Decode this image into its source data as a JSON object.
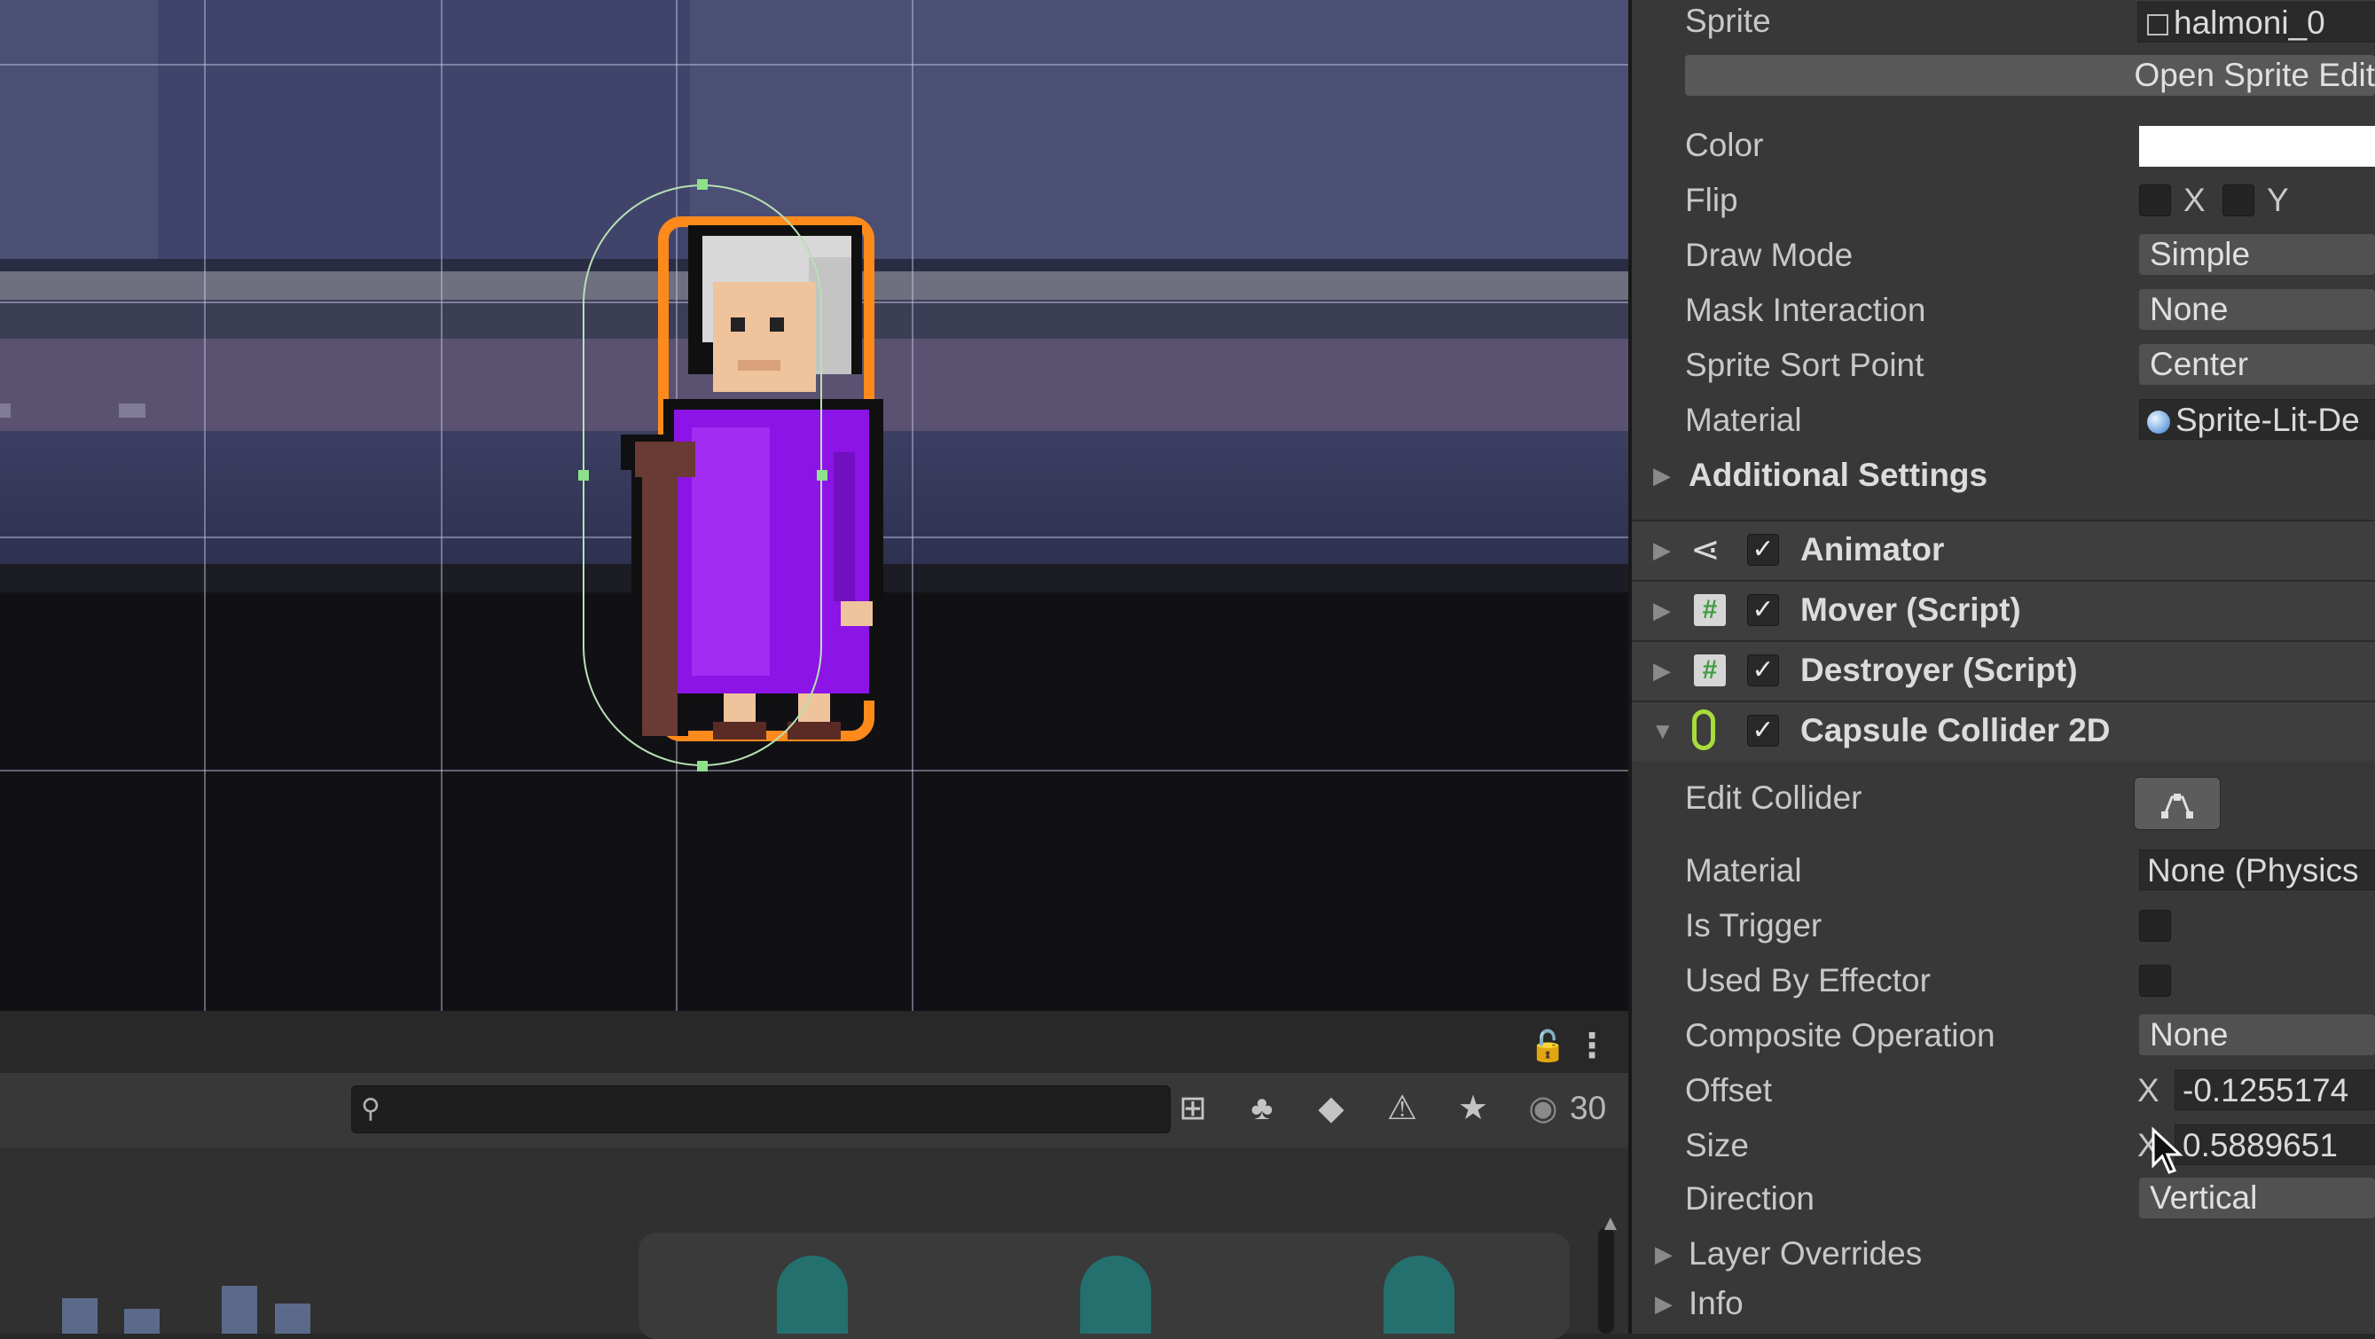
{
  "inspector": {
    "sprite_label": "Sprite",
    "sprite_value": "halmoni_0",
    "open_sprite_editor": "Open Sprite Edit",
    "color_label": "Color",
    "color_value": "#ffffff",
    "flip_label": "Flip",
    "flip_x": "X",
    "flip_y": "Y",
    "draw_mode_label": "Draw Mode",
    "draw_mode_value": "Simple",
    "mask_label": "Mask Interaction",
    "mask_value": "None",
    "sort_point_label": "Sprite Sort Point",
    "sort_point_value": "Center",
    "material_label": "Material",
    "material_value": "Sprite-Lit-De",
    "additional_settings": "Additional Settings"
  },
  "components": {
    "animator": "Animator",
    "mover": "Mover (Script)",
    "destroyer": "Destroyer (Script)",
    "capsule": "Capsule Collider 2D"
  },
  "collider": {
    "edit_label": "Edit Collider",
    "material_label": "Material",
    "material_value": "None (Physics",
    "trigger_label": "Is Trigger",
    "effector_label": "Used By Effector",
    "composite_label": "Composite Operation",
    "composite_value": "None",
    "offset_label": "Offset",
    "offset_axis": "X",
    "offset_x": "-0.1255174",
    "size_label": "Size",
    "size_axis": "X",
    "size_x": "0.5889651",
    "direction_label": "Direction",
    "direction_value": "Vertical",
    "layer_overrides": "Layer Overrides",
    "info": "Info"
  },
  "project": {
    "visible_count": "30"
  },
  "icons": [
    "lock-icon",
    "more-icon",
    "search-icon",
    "scene-search-icon",
    "type-filter-icon",
    "label-filter-icon",
    "warning-icon",
    "favorite-icon",
    "eye-icon"
  ]
}
